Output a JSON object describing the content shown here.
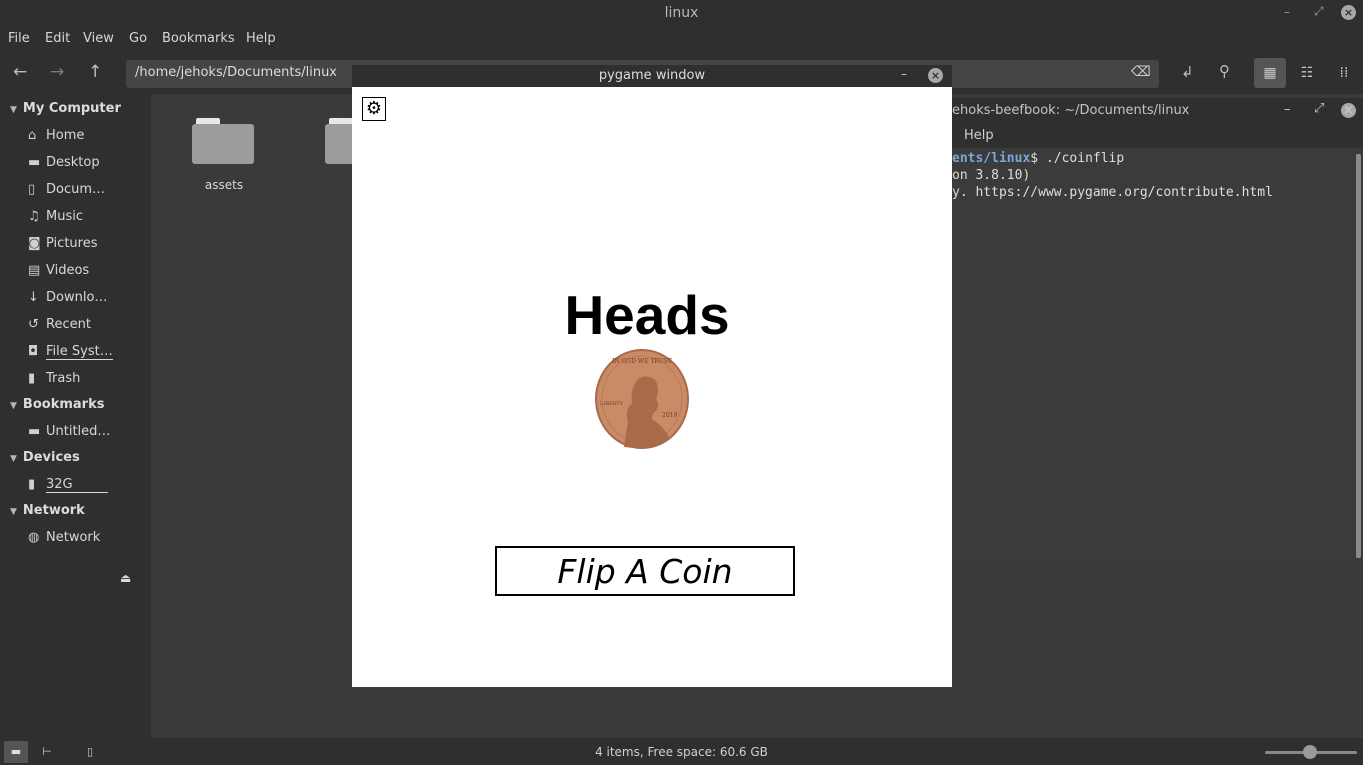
{
  "window": {
    "title": "linux"
  },
  "menubar": [
    "File",
    "Edit",
    "View",
    "Go",
    "Bookmarks",
    "Help"
  ],
  "toolbar": {
    "path": "/home/jehoks/Documents/linux"
  },
  "sidebar": {
    "sections": [
      {
        "title": "My Computer",
        "items": [
          {
            "label": "Home",
            "icon": "home-icon"
          },
          {
            "label": "Desktop",
            "icon": "desktop-icon"
          },
          {
            "label": "Docum…",
            "icon": "document-icon"
          },
          {
            "label": "Music",
            "icon": "music-icon"
          },
          {
            "label": "Pictures",
            "icon": "camera-icon"
          },
          {
            "label": "Videos",
            "icon": "film-icon"
          },
          {
            "label": "Downlo…",
            "icon": "download-icon"
          },
          {
            "label": "Recent",
            "icon": "history-icon"
          },
          {
            "label": "File Syst…",
            "icon": "drive-icon"
          },
          {
            "label": "Trash",
            "icon": "trash-icon"
          }
        ]
      },
      {
        "title": "Bookmarks",
        "items": [
          {
            "label": "Untitled…",
            "icon": "folder-icon"
          }
        ]
      },
      {
        "title": "Devices",
        "items": [
          {
            "label": "32G",
            "icon": "usb-icon"
          }
        ]
      },
      {
        "title": "Network",
        "items": [
          {
            "label": "Network",
            "icon": "globe-icon"
          }
        ]
      }
    ]
  },
  "content": {
    "folders": [
      {
        "label": "assets"
      }
    ]
  },
  "statusbar": {
    "text": "4 items, Free space: 60.6 GB"
  },
  "terminal": {
    "title": "ehoks-beefbook: ~/Documents/linux",
    "menu_help": "Help",
    "prompt_path": "ents/linux",
    "command": "$ ./coinflip",
    "line2": "on 3.8.10)",
    "line3": "y. https://www.pygame.org/contribute.html"
  },
  "pygame": {
    "title": "pygame window",
    "result": "Heads",
    "button": "Flip A Coin",
    "coin": {
      "motto": "IN GOD WE TRUST",
      "liberty": "LIBERTY",
      "year": "2019"
    }
  },
  "colors": {
    "window_bg": "#2f2f2f",
    "content_bg": "#3a3a3a",
    "accent": "#7aa6d8",
    "coin": "#c98a66"
  }
}
